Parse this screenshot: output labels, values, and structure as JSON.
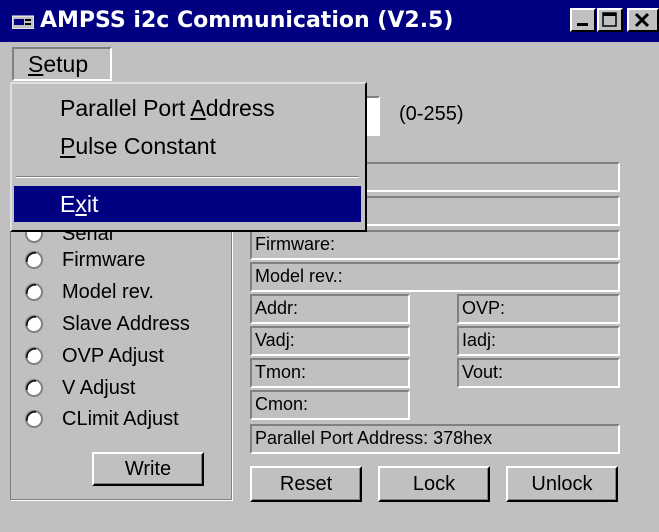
{
  "window": {
    "title": "AMPSS i2c Communication (V2.5)",
    "icon": "app-icon"
  },
  "menu": {
    "setup_label_ul": "S",
    "setup_label_rest": "etup",
    "items": [
      {
        "pre": "Parallel Port ",
        "ul": "A",
        "post": "ddress"
      },
      {
        "pre": "",
        "ul": "P",
        "post": "ulse Constant"
      },
      {
        "pre": "E",
        "ul": "x",
        "post": "it"
      }
    ]
  },
  "range_label": "(0-255)",
  "radio_options": [
    "Serial",
    "Firmware",
    "Model rev.",
    "Slave Address",
    "OVP Adjust",
    "V Adjust",
    "CLimit Adjust"
  ],
  "fields": {
    "firmware": "Firmware:",
    "model_rev": "Model rev.:",
    "addr": "Addr:",
    "vadj": "Vadj:",
    "tmon": "Tmon:",
    "cmon": "Cmon:",
    "ovp": "OVP:",
    "iadj": "Iadj:",
    "vout": "Vout:",
    "parallel_port": "Parallel Port Address: 378hex"
  },
  "buttons": {
    "write": "Write",
    "reset": "Reset",
    "lock": "Lock",
    "unlock": "Unlock"
  },
  "colors": {
    "titlebar": "#000080",
    "face": "#c0c0c0",
    "highlight": "#000080"
  }
}
